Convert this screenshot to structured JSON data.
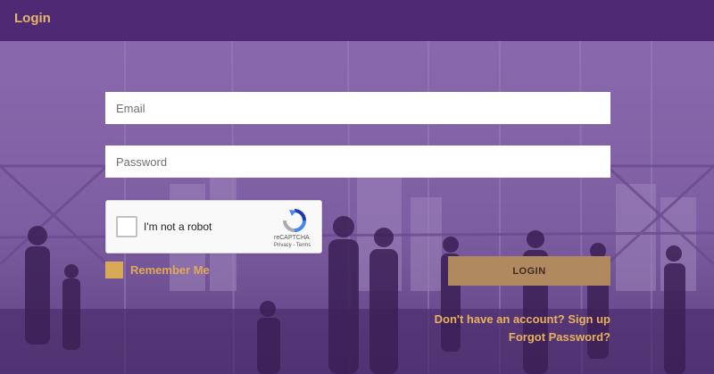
{
  "header": {
    "title": "Login"
  },
  "form": {
    "email_placeholder": "Email",
    "password_placeholder": "Password",
    "remember_label": "Remember Me",
    "login_button": "LOGIN"
  },
  "captcha": {
    "label": "I'm not a robot",
    "brand": "reCAPTCHA",
    "links": "Privacy - Terms"
  },
  "links": {
    "signup": "Don't have an account?  Sign up",
    "forgot": "Forgot Password?"
  },
  "colors": {
    "header_bg": "#4f2a74",
    "accent": "#e7b766",
    "button_bg": "#b08a5e"
  }
}
